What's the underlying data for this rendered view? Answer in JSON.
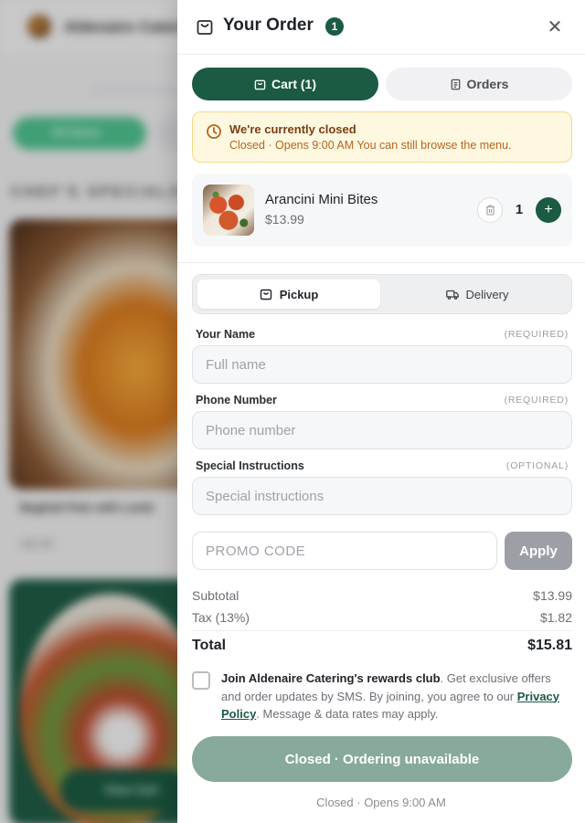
{
  "background": {
    "brand": "Aldenaire Caterin",
    "category_pill": "All Items",
    "section_heading": "CHEF'S SPECIALS",
    "card1_title": "Baghali Polo with Lamb",
    "card1_price": "$24.99",
    "view_cart": "View Cart"
  },
  "drawer": {
    "title": "Your Order",
    "badge_count": "1",
    "close_icon": "close-icon",
    "tabs": {
      "cart_label": "Cart (1)",
      "orders_label": "Orders"
    },
    "status": {
      "title": "We're currently closed",
      "message": "Closed · Opens 9:00 AM You can still browse the menu."
    },
    "item": {
      "name": "Arancini Mini Bites",
      "price": "$13.99",
      "quantity": "1",
      "plus": "+"
    },
    "fulfillment": {
      "pickup_label": "Pickup",
      "delivery_label": "Delivery"
    },
    "fields": {
      "name_label": "Your Name",
      "name_req": "(REQUIRED)",
      "name_placeholder": "Full name",
      "phone_label": "Phone Number",
      "phone_req": "(REQUIRED)",
      "phone_placeholder": "Phone number",
      "instructions_label": "Special Instructions",
      "instructions_req": "(OPTIONAL)",
      "instructions_placeholder": "Special instructions"
    },
    "promo": {
      "placeholder": "PROMO CODE",
      "apply_label": "Apply"
    },
    "totals": {
      "subtotal_label": "Subtotal",
      "subtotal_value": "$13.99",
      "tax_label": "Tax (13%)",
      "tax_value": "$1.82",
      "total_label": "Total",
      "total_value": "$15.81"
    },
    "rewards": {
      "bold": "Join Aldenaire Catering's rewards club",
      "text1": ". Get exclusive offers and order updates by SMS. By joining, you agree to our ",
      "link": "Privacy Policy",
      "text2": ". Message & data rates may apply."
    },
    "cta_label": "Closed · Ordering unavailable",
    "footer_note": "Closed · Opens 9:00 AM"
  },
  "colors": {
    "brand_green": "#1b5a43",
    "warning_bg": "#fff8e1",
    "warning_text": "#b5641c",
    "disabled_cta": "#88aa9a"
  }
}
